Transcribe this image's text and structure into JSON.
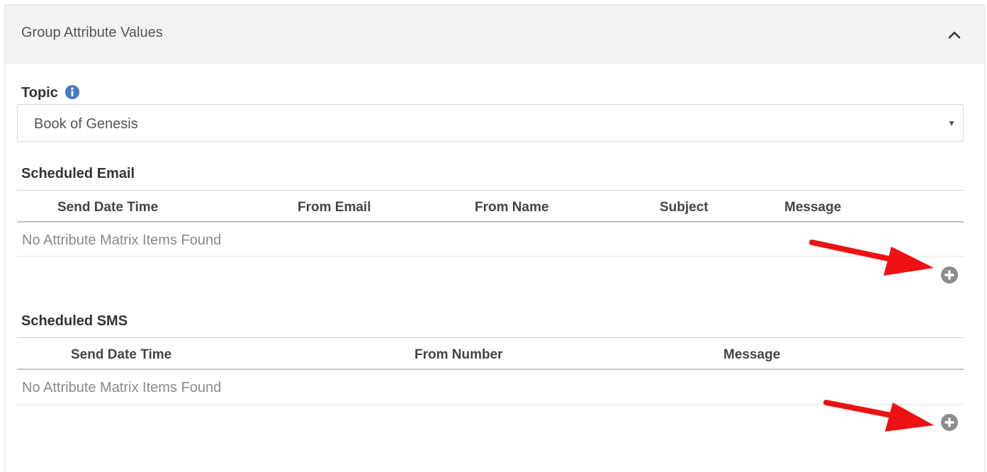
{
  "panel": {
    "title": "Group Attribute Values"
  },
  "topic": {
    "label": "Topic",
    "selected_value": "Book of Genesis"
  },
  "scheduled_email": {
    "label": "Scheduled Email",
    "columns": [
      "Send Date Time",
      "From Email",
      "From Name",
      "Subject",
      "Message"
    ],
    "empty_message": "No Attribute Matrix Items Found"
  },
  "scheduled_sms": {
    "label": "Scheduled SMS",
    "columns": [
      "Send Date Time",
      "From Number",
      "Message"
    ],
    "empty_message": "No Attribute Matrix Items Found"
  },
  "icons": {
    "collapse": "chevron-up-icon",
    "info": "info-circle-icon",
    "add": "plus-circle-icon",
    "annotation": "red-arrow-icon"
  },
  "colors": {
    "header_bg": "#f3f3f3",
    "info_icon": "#4a7bbf",
    "add_icon": "#8c8c8c",
    "annotation_arrow": "#ee1111"
  }
}
